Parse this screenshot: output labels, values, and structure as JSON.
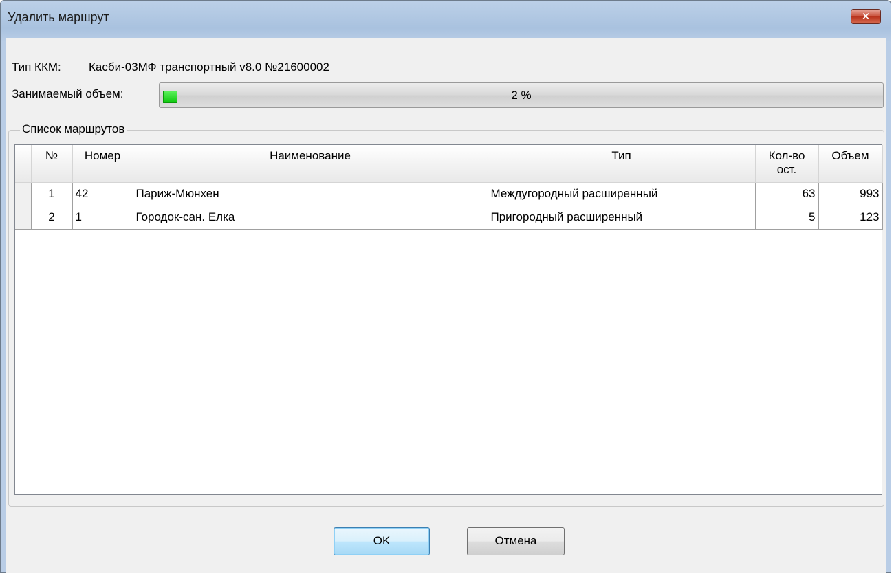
{
  "window": {
    "title": "Удалить маршрут",
    "close_icon": "close-icon"
  },
  "kkm": {
    "label": "Тип ККМ:",
    "value": "Касби-03МФ транспортный v8.0 №21600002"
  },
  "volume": {
    "label": "Занимаемый объем:",
    "percent_text": "2 %",
    "fraction": 0.02,
    "fill_color": "#22cc22"
  },
  "routes_group": {
    "legend": "Список маршрутов",
    "columns": {
      "n": "№",
      "number": "Номер",
      "name": "Наименование",
      "type": "Тип",
      "stops_line1": "Кол-во",
      "stops_line2": "ост.",
      "volume": "Объем"
    },
    "rows": [
      {
        "n": "1",
        "number": "42",
        "name": "Париж-Мюнхен",
        "type": "Междугородный расширенный",
        "stops": "63",
        "volume": "993"
      },
      {
        "n": "2",
        "number": "1",
        "name": "Городок-сан. Елка",
        "type": "Пригородный расширенный",
        "stops": "5",
        "volume": "123"
      }
    ]
  },
  "buttons": {
    "ok": "OK",
    "cancel": "Отмена"
  }
}
